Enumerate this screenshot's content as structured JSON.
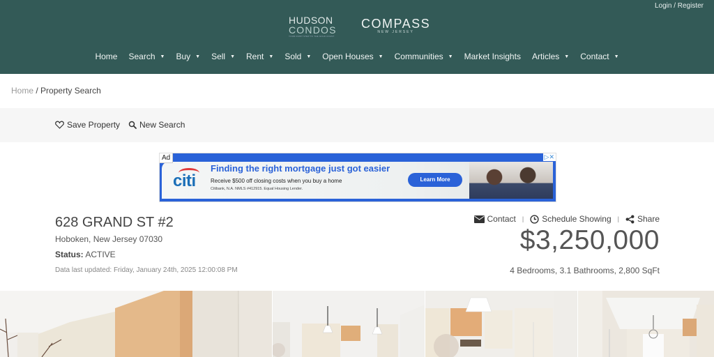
{
  "header": {
    "login_label": "Login / Register",
    "logos": {
      "hudson_line1": "HUDSON",
      "hudson_line2": "CONDOS",
      "hudson_tagline": "YOUR FIRST STEP TO THE GOLD COAST",
      "compass_name": "COMPASS",
      "compass_region": "NEW JERSEY"
    },
    "nav": [
      {
        "label": "Home",
        "has_dropdown": false
      },
      {
        "label": "Search",
        "has_dropdown": true
      },
      {
        "label": "Buy",
        "has_dropdown": true
      },
      {
        "label": "Sell",
        "has_dropdown": true
      },
      {
        "label": "Rent",
        "has_dropdown": true
      },
      {
        "label": "Sold",
        "has_dropdown": true
      },
      {
        "label": "Open Houses",
        "has_dropdown": true
      },
      {
        "label": "Communities",
        "has_dropdown": true
      },
      {
        "label": "Market Insights",
        "has_dropdown": false
      },
      {
        "label": "Articles",
        "has_dropdown": true
      },
      {
        "label": "Contact",
        "has_dropdown": true
      }
    ],
    "caret": "▼",
    "bg_color": "#335a57"
  },
  "breadcrumb": {
    "home": "Home",
    "separator": "/",
    "current": "Property Search"
  },
  "toolbar": {
    "save_label": "Save Property",
    "new_search_label": "New Search"
  },
  "ad": {
    "badge": "Ad",
    "brand": "citi",
    "headline": "Finding the right mortgage just got easier",
    "subline": "Receive $500 off closing costs when you buy a home",
    "fineprint": "Citibank, N.A. NMLS #412915. Equal Housing Lender.",
    "cta": "Learn More",
    "close_glyphs": "▷✕",
    "accent_color": "#2a62d8"
  },
  "property": {
    "address": "628 GRAND ST #2",
    "city_line": "Hoboken, New Jersey 07030",
    "status_label": "Status:",
    "status_value": "ACTIVE",
    "updated_label": "Data last updated:",
    "updated_value": "Friday, January 24th, 2025 12:00:08 PM",
    "price": "$3,250,000",
    "specs": "4 Bedrooms, 3.1 Bathrooms, 2,800 SqFt"
  },
  "actions": [
    {
      "label": "Contact",
      "icon": "envelope-icon"
    },
    {
      "label": "Schedule Showing",
      "icon": "clock-icon"
    },
    {
      "label": "Share",
      "icon": "share-icon"
    }
  ],
  "action_divider": "|",
  "gallery": {
    "photos": [
      {
        "description": "Living area with wood wall panel and cabinets"
      },
      {
        "description": "Kitchen with pendant light"
      },
      {
        "description": "Kitchen with white pendant and cabinets"
      },
      {
        "description": "Hallway view toward window with chandelier"
      }
    ]
  }
}
